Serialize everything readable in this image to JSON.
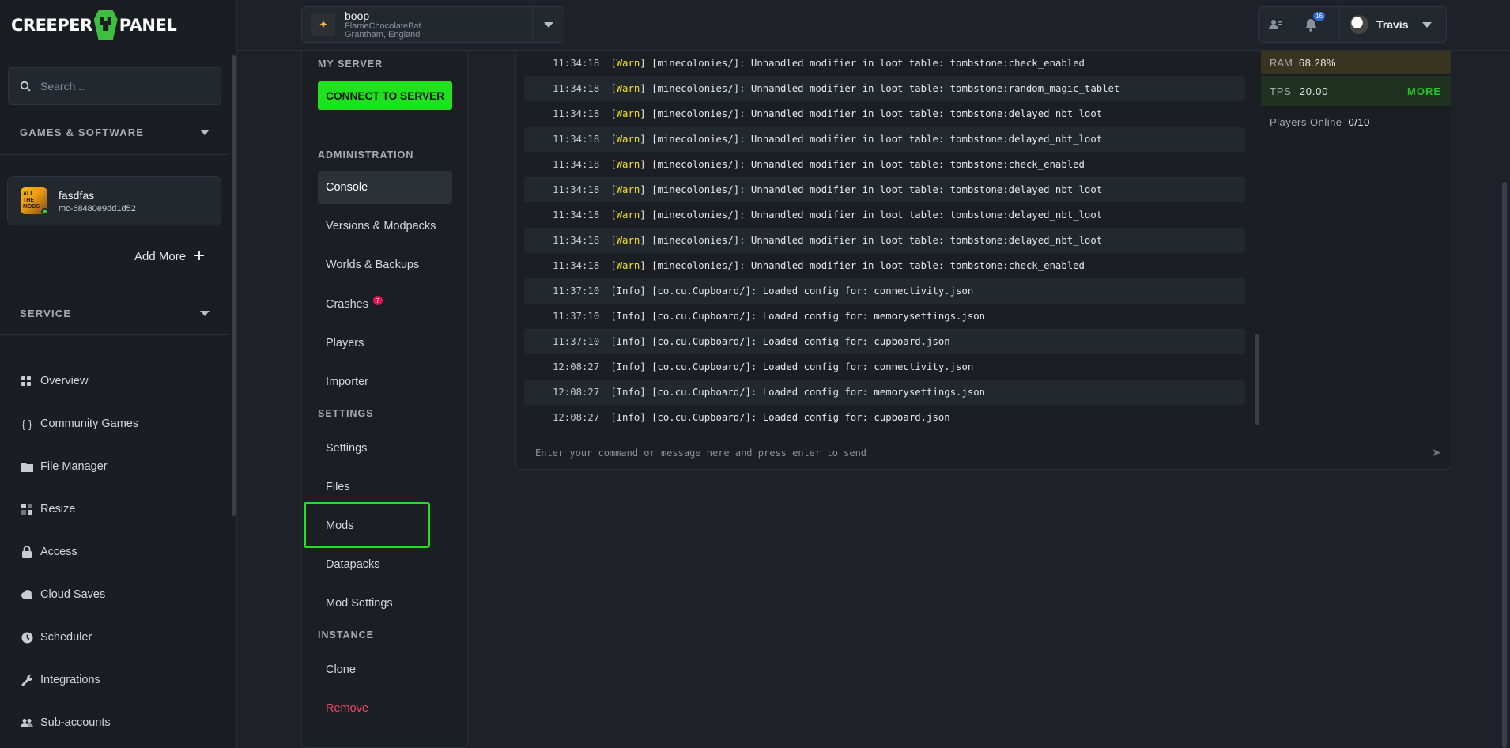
{
  "app": {
    "logo_left": "CREEPER",
    "logo_right": "PANEL"
  },
  "sidebar": {
    "search_placeholder": "Search...",
    "games_section": "GAMES & SOFTWARE",
    "server": {
      "name": "fasdfas",
      "id": "mc-68480e9dd1d52",
      "thumb_text": "ALL THE MODS"
    },
    "add_more": "Add More",
    "service_section": "SERVICE",
    "items": [
      {
        "label": "Overview",
        "icon": "grid-icon"
      },
      {
        "label": "Community Games",
        "icon": "braces-icon"
      },
      {
        "label": "File Manager",
        "icon": "folder-icon"
      },
      {
        "label": "Resize",
        "icon": "resize-icon"
      },
      {
        "label": "Access",
        "icon": "lock-icon"
      },
      {
        "label": "Cloud Saves",
        "icon": "cloud-icon"
      },
      {
        "label": "Scheduler",
        "icon": "clock-icon"
      },
      {
        "label": "Integrations",
        "icon": "wrench-icon"
      },
      {
        "label": "Sub-accounts",
        "icon": "users-icon"
      }
    ]
  },
  "topbar": {
    "server_title": "boop",
    "server_sub1": "FlameChocolateBat",
    "server_sub2": "Grantham, England",
    "notifications_count": "16",
    "user_name": "Travis"
  },
  "subnav": {
    "my_server": "MY SERVER",
    "connect": "CONNECT TO SERVER",
    "administration": "ADMINISTRATION",
    "admin_items": [
      "Console",
      "Versions & Modpacks",
      "Worlds & Backups",
      "Crashes",
      "Players",
      "Importer"
    ],
    "crash_count": "7",
    "settings": "SETTINGS",
    "settings_items": [
      "Settings",
      "Files",
      "Mods",
      "Datapacks",
      "Mod Settings"
    ],
    "instance": "INSTANCE",
    "instance_items": [
      "Clone",
      "Remove"
    ]
  },
  "console": {
    "lines": [
      {
        "time": "11:34:18",
        "level": "Warn",
        "msg": "[minecolonies/]: Unhandled modifier in loot table: tombstone:check_enabled"
      },
      {
        "time": "11:34:18",
        "level": "Warn",
        "msg": "[minecolonies/]: Unhandled modifier in loot table: tombstone:random_magic_tablet"
      },
      {
        "time": "11:34:18",
        "level": "Warn",
        "msg": "[minecolonies/]: Unhandled modifier in loot table: tombstone:delayed_nbt_loot"
      },
      {
        "time": "11:34:18",
        "level": "Warn",
        "msg": "[minecolonies/]: Unhandled modifier in loot table: tombstone:delayed_nbt_loot"
      },
      {
        "time": "11:34:18",
        "level": "Warn",
        "msg": "[minecolonies/]: Unhandled modifier in loot table: tombstone:check_enabled"
      },
      {
        "time": "11:34:18",
        "level": "Warn",
        "msg": "[minecolonies/]: Unhandled modifier in loot table: tombstone:delayed_nbt_loot"
      },
      {
        "time": "11:34:18",
        "level": "Warn",
        "msg": "[minecolonies/]: Unhandled modifier in loot table: tombstone:delayed_nbt_loot"
      },
      {
        "time": "11:34:18",
        "level": "Warn",
        "msg": "[minecolonies/]: Unhandled modifier in loot table: tombstone:delayed_nbt_loot"
      },
      {
        "time": "11:34:18",
        "level": "Warn",
        "msg": "[minecolonies/]: Unhandled modifier in loot table: tombstone:check_enabled"
      },
      {
        "time": "11:37:10",
        "level": "Info",
        "msg": "[co.cu.Cupboard/]: Loaded config for: connectivity.json"
      },
      {
        "time": "11:37:10",
        "level": "Info",
        "msg": "[co.cu.Cupboard/]: Loaded config for: memorysettings.json"
      },
      {
        "time": "11:37:10",
        "level": "Info",
        "msg": "[co.cu.Cupboard/]: Loaded config for: cupboard.json"
      },
      {
        "time": "12:08:27",
        "level": "Info",
        "msg": "[co.cu.Cupboard/]: Loaded config for: connectivity.json"
      },
      {
        "time": "12:08:27",
        "level": "Info",
        "msg": "[co.cu.Cupboard/]: Loaded config for: memorysettings.json"
      },
      {
        "time": "12:08:27",
        "level": "Info",
        "msg": "[co.cu.Cupboard/]: Loaded config for: cupboard.json"
      }
    ],
    "input_placeholder": "Enter your command or message here and press enter to send"
  },
  "stats": {
    "ram_label": "RAM",
    "ram_value": "68.28%",
    "tps_label": "TPS",
    "tps_value": "20.00",
    "more": "MORE",
    "players_label": "Players Online",
    "players_value": "0/10"
  },
  "colors": {
    "accent": "#1fe21f",
    "warn": "#f2e51a",
    "danger": "#f0456a"
  }
}
